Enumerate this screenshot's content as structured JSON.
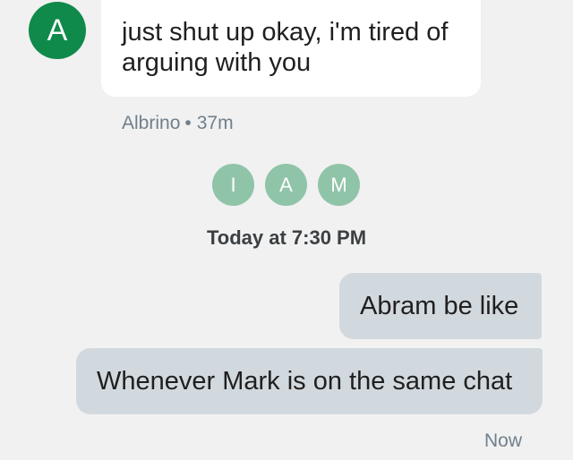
{
  "incoming": {
    "avatar_initial": "A",
    "message_text": "just shut up okay, i'm tired of arguing with you",
    "sender_name": "Albrino",
    "separator": "•",
    "time_ago": "37m"
  },
  "read_receipts": [
    {
      "initial": "I"
    },
    {
      "initial": "A"
    },
    {
      "initial": "M"
    }
  ],
  "timestamp": "Today at 7:30 PM",
  "outgoing": [
    {
      "text": "Abram be like"
    },
    {
      "text": "Whenever Mark is on the same chat"
    }
  ],
  "outgoing_status": "Now",
  "colors": {
    "background": "#f1f1f1",
    "incoming_avatar": "#0f8a4a",
    "read_receipt": "#8fc4a8",
    "outgoing_bubble": "#d2d9de",
    "meta_text": "#70808c"
  }
}
